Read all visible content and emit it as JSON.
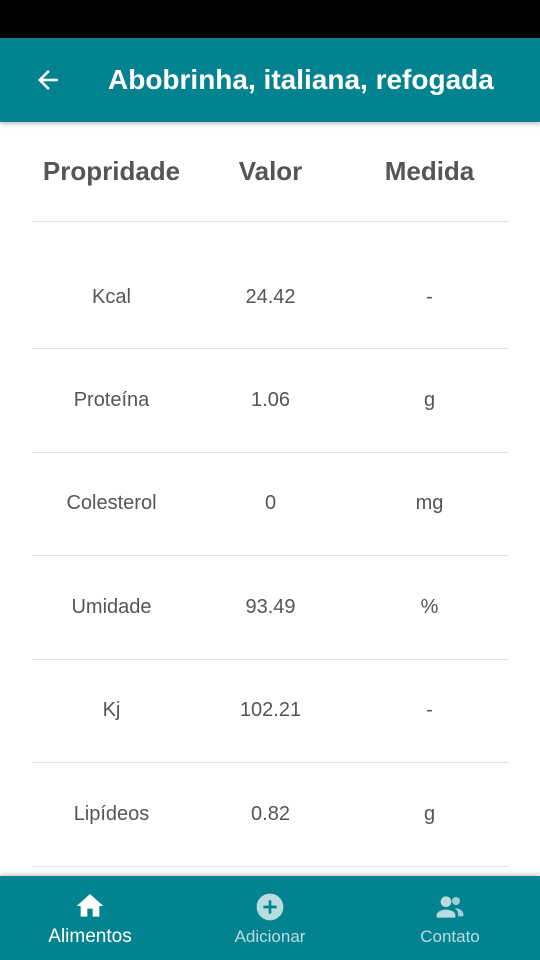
{
  "app_bar": {
    "title": "Abobrinha, italiana, refogada",
    "back_icon": "arrow-left-icon"
  },
  "table": {
    "headers": [
      "Propridade",
      "Valor",
      "Medida"
    ],
    "rows": [
      {
        "property": "Kcal",
        "value": "24.42",
        "unit": "-"
      },
      {
        "property": "Proteína",
        "value": "1.06",
        "unit": "g"
      },
      {
        "property": "Colesterol",
        "value": "0",
        "unit": "mg"
      },
      {
        "property": "Umidade",
        "value": "93.49",
        "unit": "%"
      },
      {
        "property": "Kj",
        "value": "102.21",
        "unit": "-"
      },
      {
        "property": "Lipídeos",
        "value": "0.82",
        "unit": "g"
      }
    ]
  },
  "bottom_nav": {
    "items": [
      {
        "label": "Alimentos",
        "icon": "home-icon",
        "active": true
      },
      {
        "label": "Adicionar",
        "icon": "add-circle-icon",
        "active": false
      },
      {
        "label": "Contato",
        "icon": "contact-icon",
        "active": false
      }
    ]
  },
  "colors": {
    "primary": "#03838f",
    "divider": "#e2e2e2",
    "text": "#555555"
  }
}
